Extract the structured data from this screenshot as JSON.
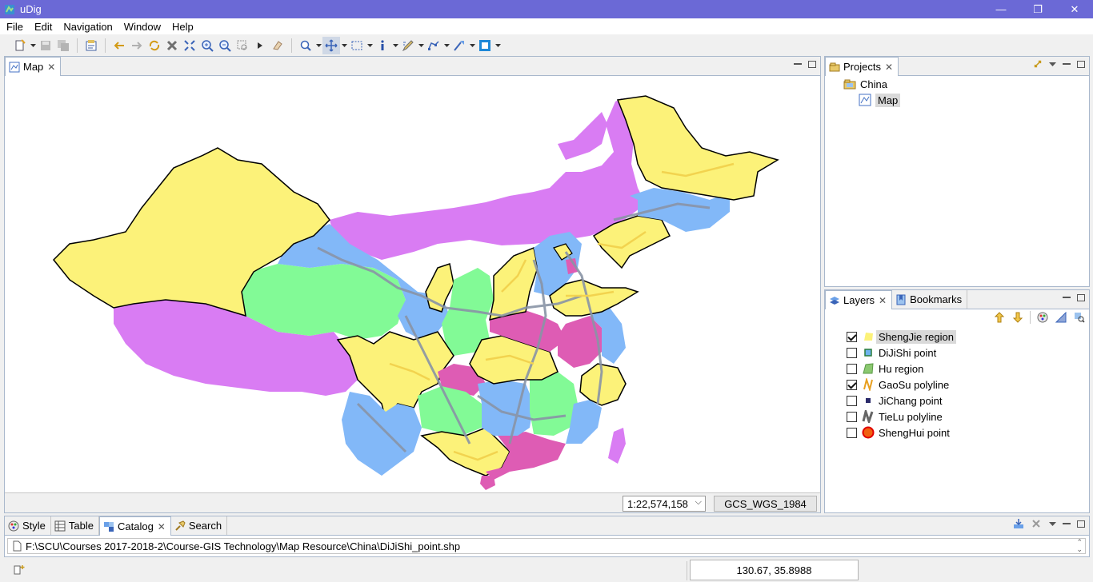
{
  "window": {
    "title": "uDig",
    "minimize_glyph": "—",
    "maximize_glyph": "❐",
    "close_glyph": "✕"
  },
  "menubar": {
    "items": [
      "File",
      "Edit",
      "Navigation",
      "Window",
      "Help"
    ]
  },
  "toolbar": {
    "icons": [
      "new-icon",
      "save-icon",
      "save-all-icon",
      "properties-icon",
      "back-icon",
      "forward-icon",
      "refresh-icon",
      "stop-icon",
      "zoom-extent-icon",
      "zoom-in-icon",
      "zoom-out-icon",
      "zoom-selection-icon",
      "next-icon",
      "eraser-icon",
      "zoom-tool-icon",
      "pan-tool-icon",
      "select-tool-icon",
      "info-tool-icon",
      "edit-tool-icon",
      "create-feature-icon",
      "edit-geometry-icon",
      "style-square-icon"
    ]
  },
  "map_view": {
    "tab_label": "Map",
    "scale": "1:22,574,158",
    "crs": "GCS_WGS_1984",
    "colors": {
      "yellow": "#fcf279",
      "magenta": "#d97cf3",
      "blue": "#82b8f8",
      "green": "#82fa96",
      "pink": "#de5cb4",
      "road": "#8994a6",
      "highway": "#f2d34f"
    }
  },
  "projects": {
    "tab_label": "Projects",
    "tree": [
      {
        "label": "China",
        "icon": "project-folder-icon"
      },
      {
        "label": "Map",
        "icon": "map-icon"
      }
    ]
  },
  "layers": {
    "tab_label": "Layers",
    "bookmarks_label": "Bookmarks",
    "items": [
      {
        "label": "ShengJie region",
        "checked": true,
        "icon": "yellow-region-icon"
      },
      {
        "label": "DiJiShi point",
        "checked": false,
        "icon": "blue-point-icon"
      },
      {
        "label": "Hu region",
        "checked": false,
        "icon": "green-region-icon"
      },
      {
        "label": "GaoSu polyline",
        "checked": true,
        "icon": "orange-polyline-icon"
      },
      {
        "label": "JiChang point",
        "checked": false,
        "icon": "navy-point-icon"
      },
      {
        "label": "TieLu polyline",
        "checked": false,
        "icon": "gray-polyline-icon"
      },
      {
        "label": "ShengHui point",
        "checked": false,
        "icon": "red-point-icon"
      }
    ]
  },
  "bottom_panel": {
    "tabs": [
      "Style",
      "Table",
      "Catalog",
      "Search"
    ],
    "path": "F:\\SCU\\Courses 2017-2018-2\\Course-GIS Technology\\Map Resource\\China\\DiJiShi_point.shp"
  },
  "statusbar": {
    "coordinates": "130.67, 35.8988"
  }
}
